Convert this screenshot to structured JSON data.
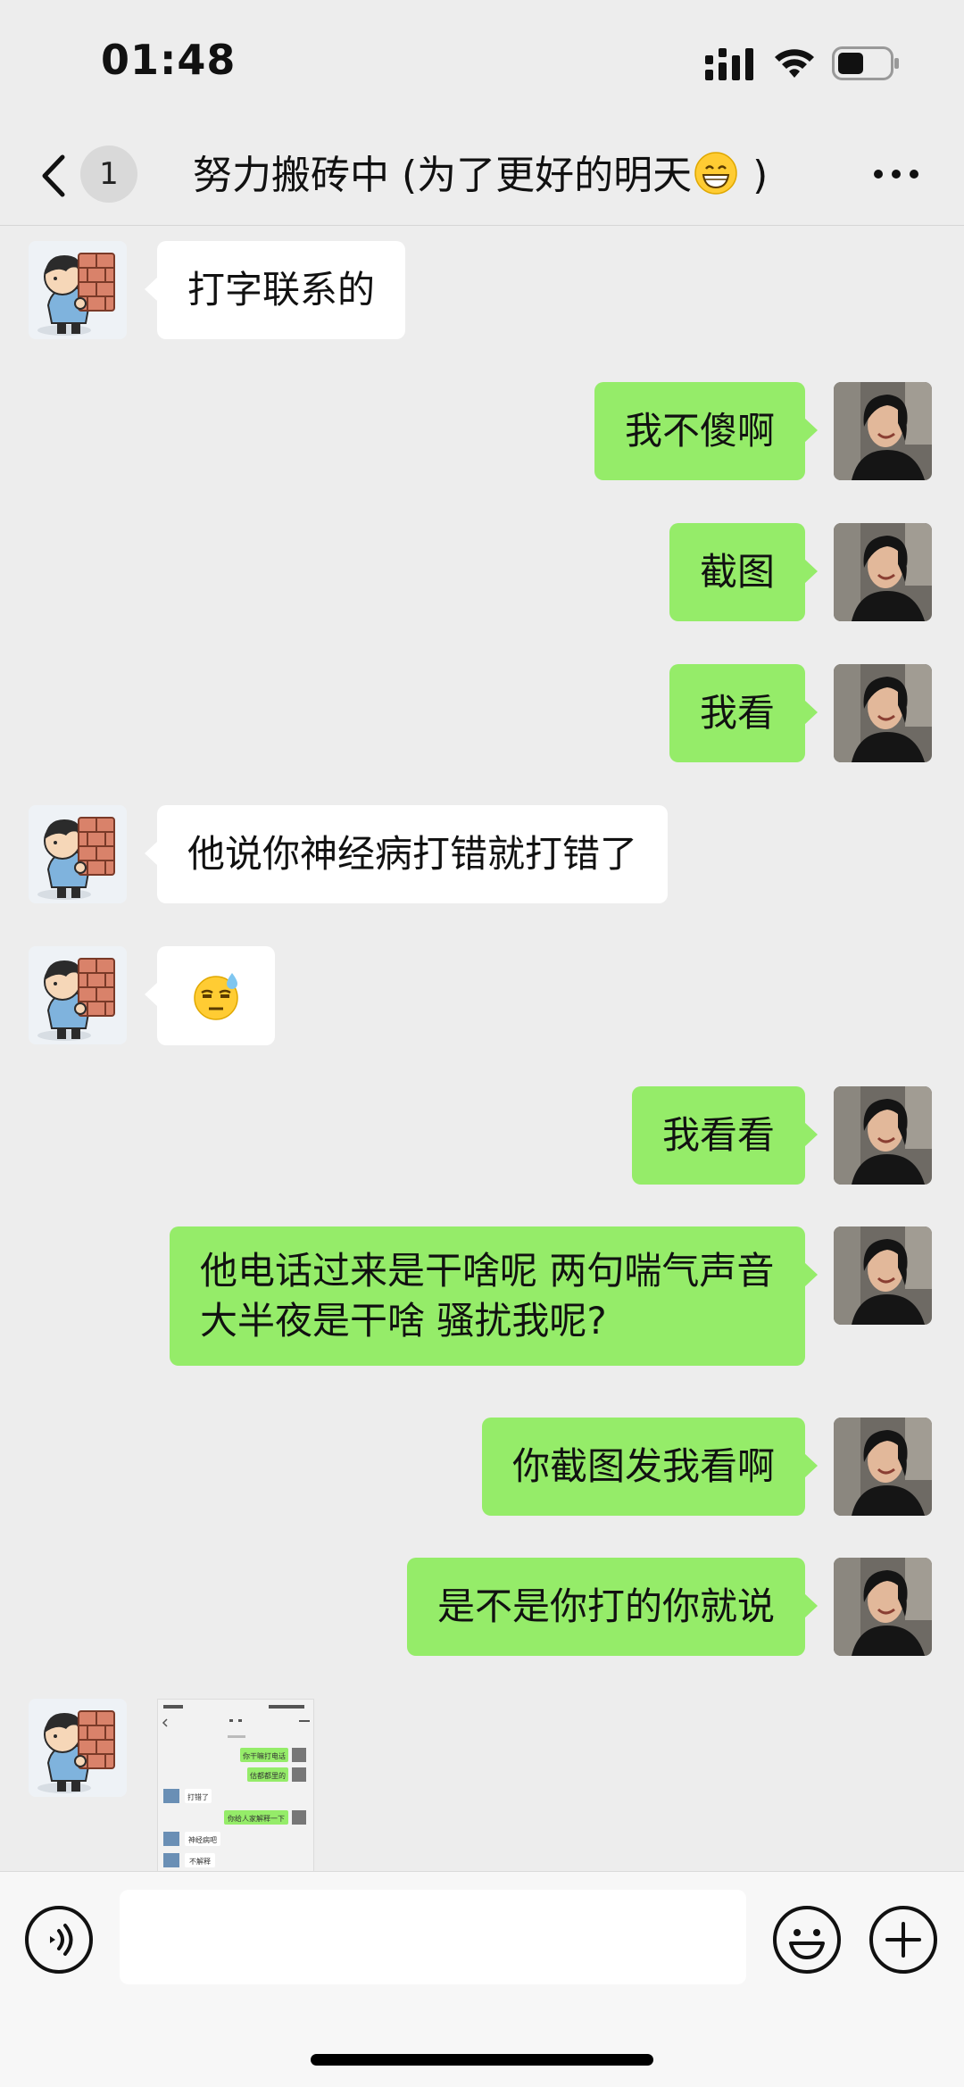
{
  "status_bar": {
    "time": "01:48"
  },
  "nav": {
    "unread_count": "1",
    "title_prefix": "努力搬砖中 (为了更好的明天",
    "title_suffix": " )",
    "title_emoji": "grinning-face-emoji"
  },
  "messages": [
    {
      "side": "in",
      "text": "打字联系的"
    },
    {
      "side": "out",
      "text": "我不傻啊"
    },
    {
      "side": "out",
      "text": "截图"
    },
    {
      "side": "out",
      "text": "我看"
    },
    {
      "side": "in",
      "text": "他说你神经病打错就打错了"
    },
    {
      "side": "in",
      "emoji": "unamused-sweat-face-emoji"
    },
    {
      "side": "out",
      "text": "我看看"
    },
    {
      "side": "out",
      "text": "他电话过来是干啥呢 两句喘气声音 大半夜是干啥 骚扰我呢?"
    },
    {
      "side": "out",
      "text": "你截图发我看啊"
    },
    {
      "side": "out",
      "text": "是不是你打的你就说"
    },
    {
      "side": "in",
      "image": "chat-screenshot-image"
    }
  ],
  "thumbnail": {
    "lines": [
      "你干嘛打电话",
      "估都都里的",
      "打错了",
      "你给人家解释一下",
      "神经病吧",
      "不解释"
    ]
  },
  "input": {
    "placeholder": "",
    "value": ""
  },
  "colors": {
    "outgoing_bubble": "#95ec69",
    "incoming_bubble": "#ffffff",
    "background": "#ededed"
  }
}
